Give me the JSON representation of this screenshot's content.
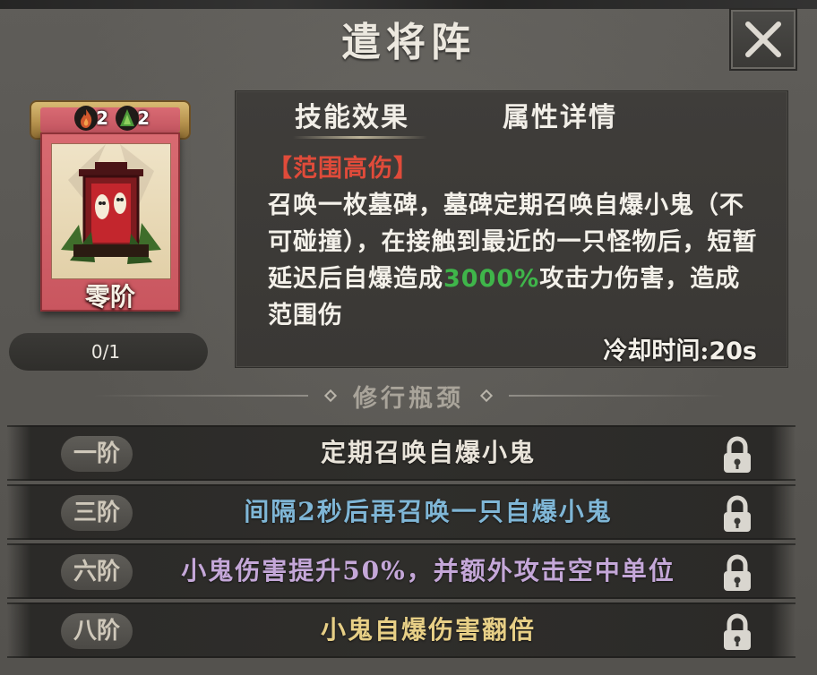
{
  "header": {
    "title": "遣将阵"
  },
  "card": {
    "badges": [
      {
        "icon": "fire-element-icon",
        "count": "2"
      },
      {
        "icon": "wood-element-icon",
        "count": "2"
      }
    ],
    "rank": "零阶",
    "progress": "0/1"
  },
  "tabs": [
    {
      "label": "技能效果",
      "active": true
    },
    {
      "label": "属性详情",
      "active": false
    }
  ],
  "skill": {
    "tag": "【范围高伤】",
    "desc_before": "召唤一枚墓碑，墓碑定期召唤自爆小鬼（不可碰撞），在接触到最近的一只怪物后，短暂延迟后自爆造成",
    "highlight": "3000%",
    "desc_after": "攻击力伤害，造成范围伤",
    "cooldown_label": "冷却时间:",
    "cooldown_value": "20s"
  },
  "section": {
    "title": "修行瓶颈"
  },
  "tiers": [
    {
      "rank": "一阶",
      "text": "定期召唤自爆小鬼",
      "color": "#e9e4da"
    },
    {
      "rank": "三阶",
      "text": "间隔2秒后再召唤一只自爆小鬼",
      "color": "#7fb6d6"
    },
    {
      "rank": "六阶",
      "text": "小鬼伤害提升50%，并额外攻击空中单位",
      "color": "#c4a7d8"
    },
    {
      "rank": "八阶",
      "text": "小鬼自爆伤害翻倍",
      "color": "#e7cf86"
    }
  ],
  "colors": {
    "tag": "#e04b3a",
    "highlight": "#3fb54a",
    "rank_pill_text": "#cfc8ba"
  }
}
